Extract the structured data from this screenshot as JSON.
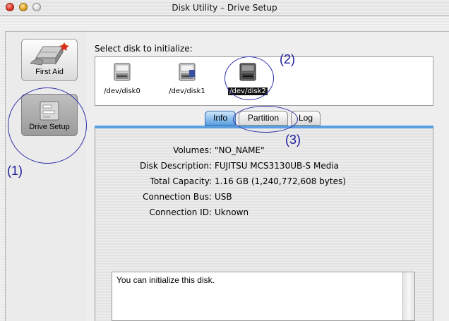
{
  "window": {
    "title": "Disk Utility – Drive Setup"
  },
  "sidebar": {
    "items": [
      {
        "label": "First Aid",
        "icon": "first-aid-icon"
      },
      {
        "label": "Drive Setup",
        "icon": "drive-setup-icon"
      }
    ]
  },
  "disk_selector": {
    "label": "Select disk to initialize:",
    "disks": [
      {
        "label": "/dev/disk0",
        "selected": false
      },
      {
        "label": "/dev/disk1",
        "selected": false
      },
      {
        "label": "/dev/disk2",
        "selected": true
      }
    ]
  },
  "tabs": [
    {
      "label": "Info",
      "active": true
    },
    {
      "label": "Partition",
      "active": false
    },
    {
      "label": "Log",
      "active": false
    }
  ],
  "info": {
    "rows": [
      {
        "key": "Volumes:",
        "value": "\"NO_NAME\""
      },
      {
        "key": "Disk Description:",
        "value": "FUJITSU MCS3130UB-S Media"
      },
      {
        "key": "Total Capacity:",
        "value": "1.16 GB (1,240,772,608 bytes)"
      },
      {
        "key": "Connection Bus:",
        "value": "USB"
      },
      {
        "key": "Connection ID:",
        "value": "Uknown"
      }
    ]
  },
  "message": "You can initialize this disk.",
  "annotations": [
    "(1)",
    "(2)",
    "(3)"
  ],
  "colors": {
    "annotation": "#2d2fa8",
    "tab_active": "#5a9fe0"
  }
}
